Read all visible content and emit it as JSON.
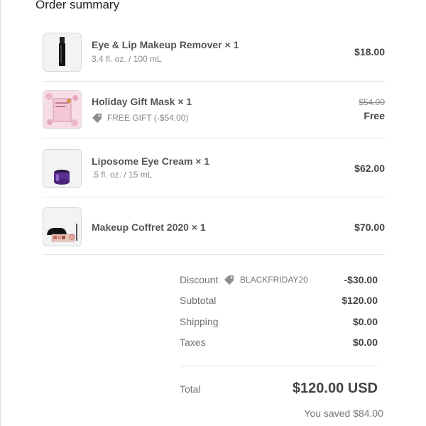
{
  "header": {
    "title": "Order summary"
  },
  "items": [
    {
      "name": "Eye & Lip Makeup Remover × 1",
      "variant": "3.4 fl. oz. / 100 mL",
      "price": "$18.00"
    },
    {
      "name": "Holiday Gift Mask × 1",
      "gift_label": "FREE GIFT (-$54.00)",
      "original_price": "$54.00",
      "price": "Free"
    },
    {
      "name": "Liposome Eye Cream × 1",
      "variant": ".5 fl. oz. / 15 mL",
      "price": "$62.00"
    },
    {
      "name": "Makeup Coffret 2020 × 1",
      "price": "$70.00"
    }
  ],
  "summary": {
    "discount": {
      "label": "Discount",
      "code": "BLACKFRIDAY20",
      "value": "-$30.00"
    },
    "subtotal": {
      "label": "Subtotal",
      "value": "$120.00"
    },
    "shipping": {
      "label": "Shipping",
      "value": "$0.00"
    },
    "taxes": {
      "label": "Taxes",
      "value": "$0.00"
    },
    "total": {
      "label": "Total",
      "value": "$120.00 USD"
    },
    "saved": "You saved $84.00"
  },
  "colors": {
    "text": "#444444",
    "muted": "#8a8a8a",
    "border": "#e6e6e6",
    "gift_pink": "#f3c8d8",
    "cream_purple": "#6a3fa0"
  }
}
